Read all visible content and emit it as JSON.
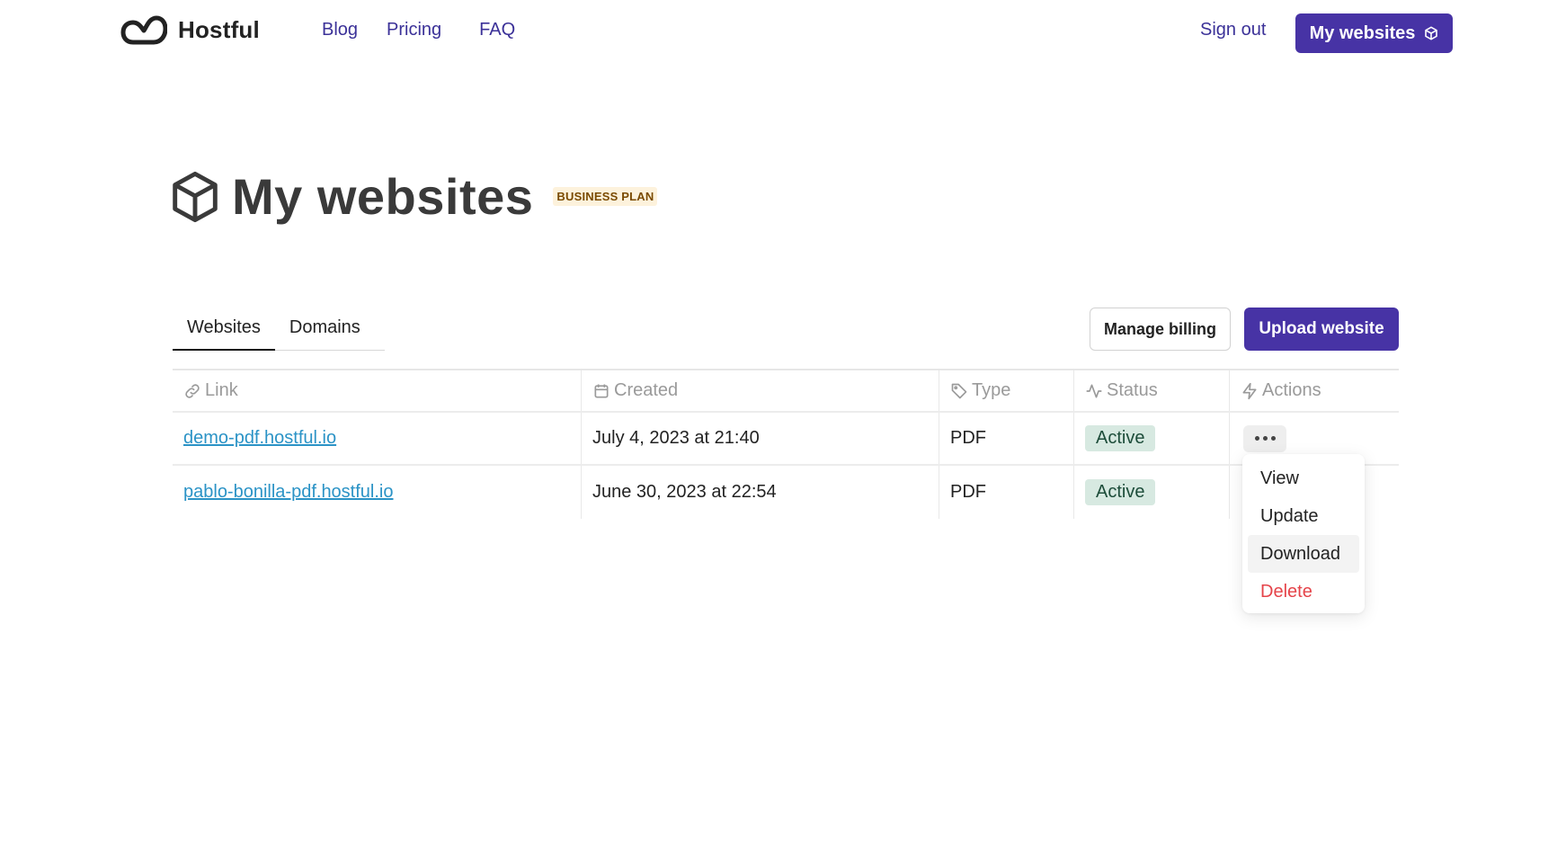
{
  "brand": {
    "name": "Hostful"
  },
  "nav": {
    "blog": "Blog",
    "pricing": "Pricing",
    "faq": "FAQ"
  },
  "header": {
    "sign_out": "Sign out",
    "my_websites": "My websites"
  },
  "page": {
    "title": "My websites",
    "plan_badge": "BUSINESS PLAN"
  },
  "tabs": [
    {
      "label": "Websites",
      "active": true
    },
    {
      "label": "Domains",
      "active": false
    }
  ],
  "actions": {
    "manage_billing": "Manage billing",
    "upload_website": "Upload website"
  },
  "table": {
    "columns": [
      "Link",
      "Created",
      "Type",
      "Status",
      "Actions"
    ],
    "rows": [
      {
        "link": "demo-pdf.hostful.io",
        "created": "July 4, 2023 at 21:40",
        "type": "PDF",
        "status": "Active"
      },
      {
        "link": "pablo-bonilla-pdf.hostful.io",
        "created": "June 30, 2023 at 22:54",
        "type": "PDF",
        "status": "Active"
      }
    ]
  },
  "dropdown": {
    "items": [
      "View",
      "Update",
      "Download",
      "Delete"
    ]
  },
  "colors": {
    "accent": "#4733a5",
    "link": "#2b93c6",
    "danger": "#e5444a",
    "status_bg": "#d7e9e1"
  },
  "icons": {
    "logo": "hostful-logo-icon",
    "cube": "cube-icon",
    "link": "link-icon",
    "calendar": "calendar-icon",
    "tag": "tag-icon",
    "activity": "activity-icon",
    "bolt": "bolt-icon",
    "more": "more-horizontal-icon"
  }
}
